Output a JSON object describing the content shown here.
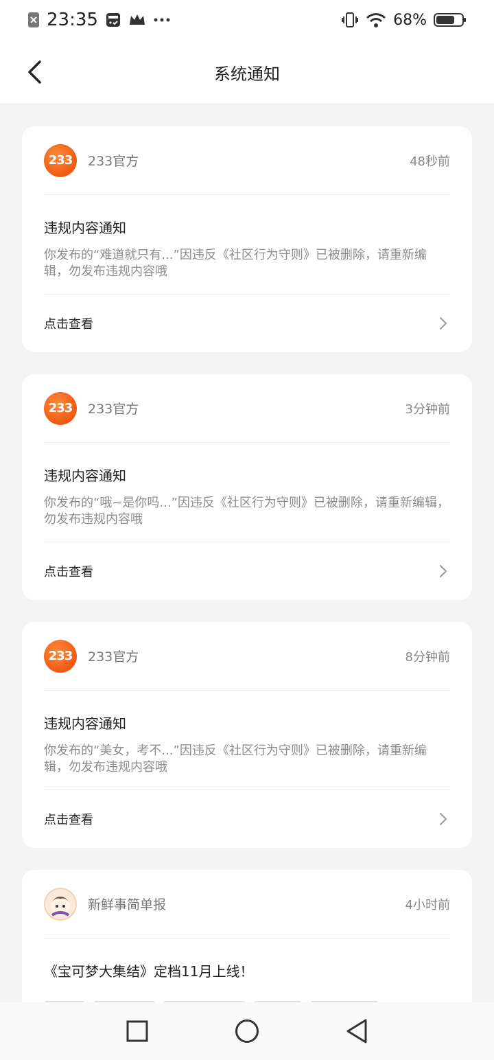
{
  "status_bar": {
    "time": "23:35",
    "battery_percent": "68%",
    "icons_left": [
      "sim-x-icon",
      "bus-card-icon",
      "crown-icon",
      "more-dots-icon"
    ],
    "icons_right": [
      "vibrate-icon",
      "wifi-icon",
      "battery-icon"
    ]
  },
  "header": {
    "title": "系统通知",
    "back_icon": "chevron-left-icon"
  },
  "notifications": [
    {
      "sender": "233官方",
      "avatar_text": "233",
      "time": "48秒前",
      "title": "违规内容通知",
      "text": "你发布的“难道就只有...”因违反《社区行为守则》已被删除，请重新编辑，勿发布违规内容哦",
      "action": "点击查看"
    },
    {
      "sender": "233官方",
      "avatar_text": "233",
      "time": "3分钟前",
      "title": "违规内容通知",
      "text": "你发布的“哦~是你吗...”因违反《社区行为守则》已被删除，请重新编辑，勿发布违规内容哦",
      "action": "点击查看"
    },
    {
      "sender": "233官方",
      "avatar_text": "233",
      "time": "8分钟前",
      "title": "违规内容通知",
      "text": "你发布的“美女，考不...”因违反《社区行为守则》已被删除，请重新编辑，勿发布违规内容哦",
      "action": "点击查看"
    },
    {
      "sender": "新鲜事简单报",
      "time": "4小时前",
      "title": "《宝可梦大集结》定档11月上线！"
    }
  ],
  "navbar": {
    "icons": [
      "recent-apps-square-icon",
      "home-circle-icon",
      "back-triangle-icon"
    ]
  },
  "colors": {
    "accent": "#f05a12",
    "background": "#f4f4f4",
    "card": "#ffffff",
    "muted_text": "#8c8c8c"
  }
}
